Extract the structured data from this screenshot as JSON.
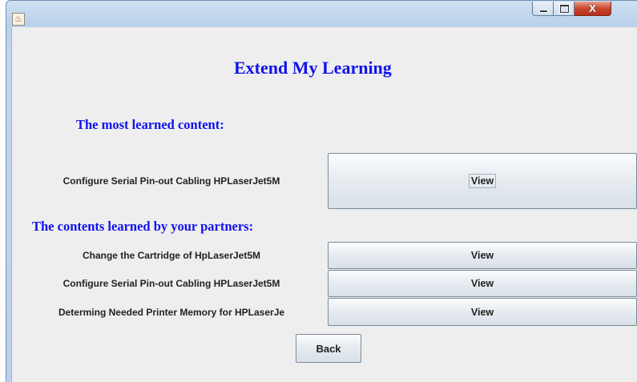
{
  "window": {
    "title": "",
    "close_glyph": "X",
    "app_icon": "java-icon"
  },
  "main": {
    "title": "Extend My Learning",
    "most_learned_heading": "The most learned content:",
    "most_learned": {
      "label": "Configure Serial Pin-out Cabling HPLaserJet5M",
      "button": "View"
    },
    "partners_heading": "The contents learned by your partners:",
    "partners": [
      {
        "label": "Change the Cartridge of HpLaserJet5M",
        "button": "View"
      },
      {
        "label": "Configure Serial Pin-out Cabling HPLaserJet5M",
        "button": "View"
      },
      {
        "label": "Determing Needed Printer Memory for HPLaserJe",
        "button": "View"
      }
    ],
    "back_button": "Back"
  }
}
